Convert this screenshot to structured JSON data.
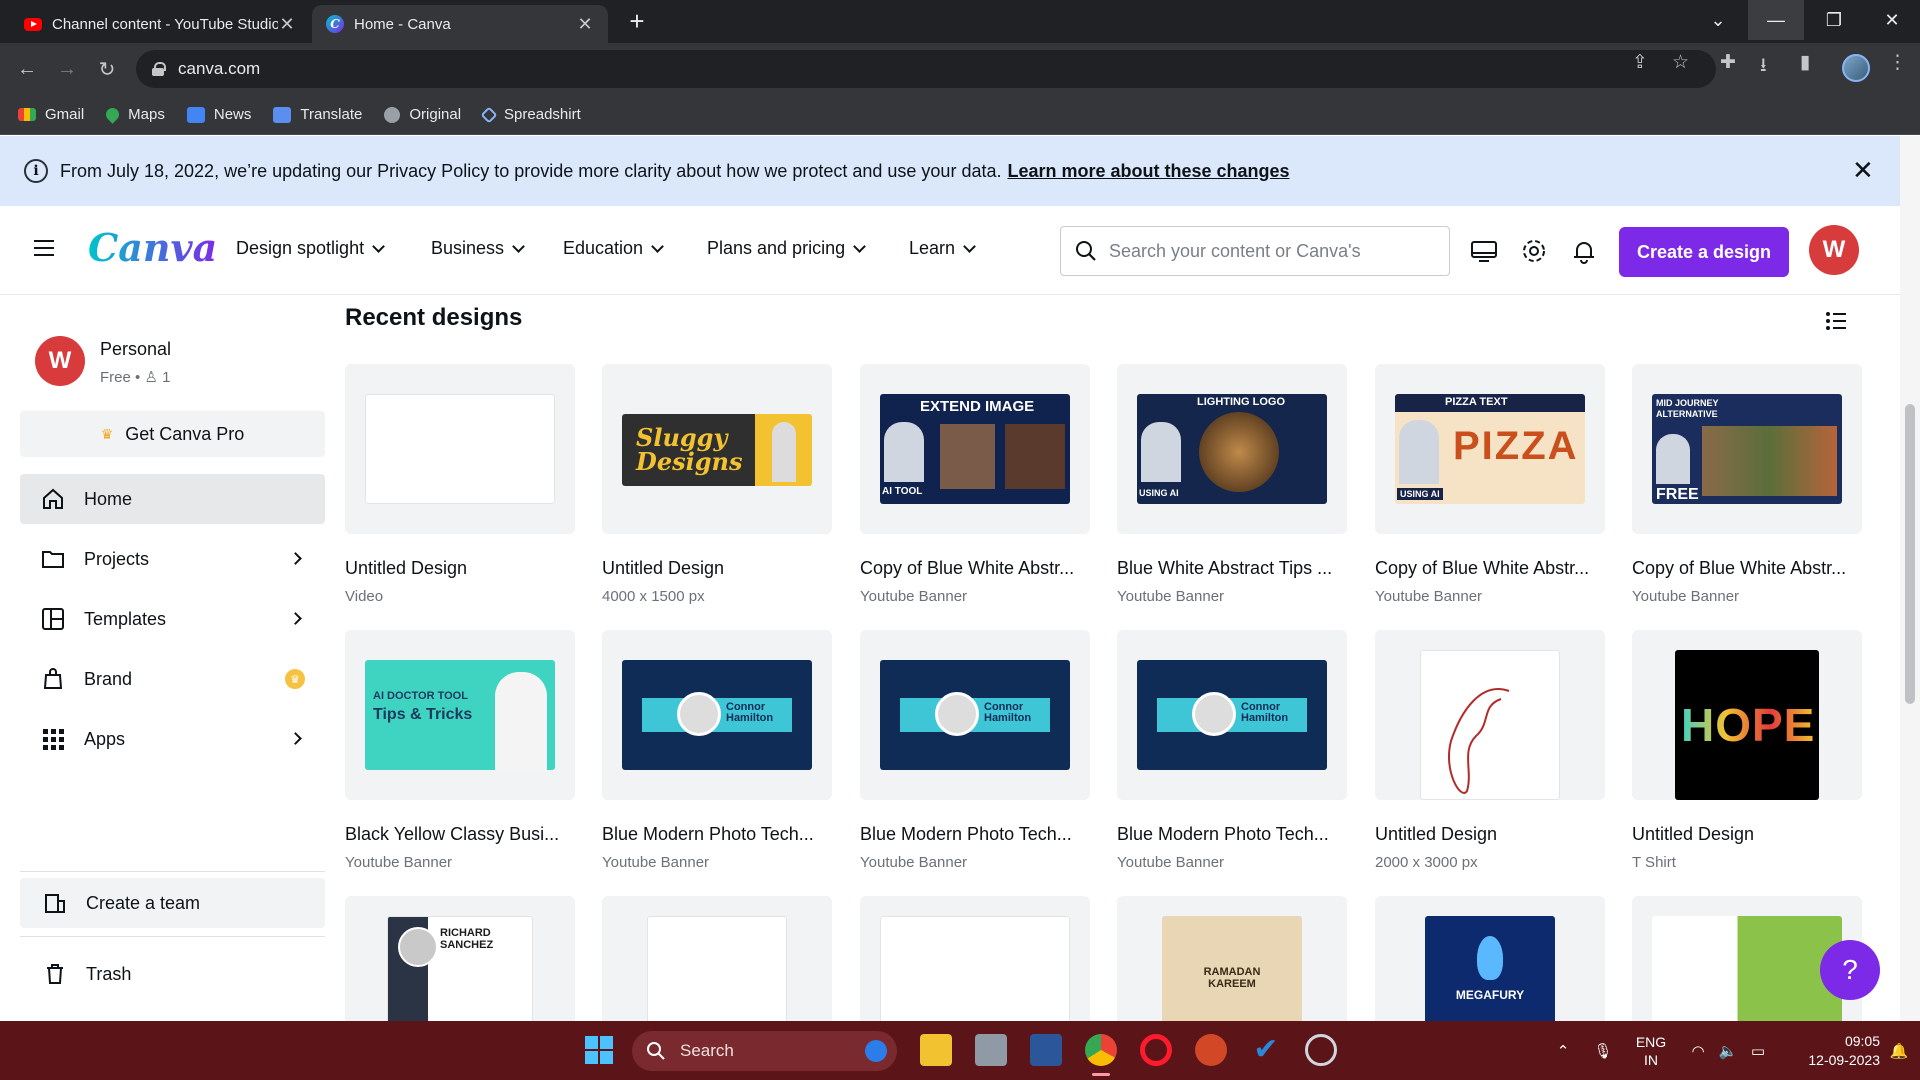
{
  "browser": {
    "tabs": [
      {
        "title": "Channel content - YouTube Studio",
        "favicon": "youtube-icon"
      },
      {
        "title": "Home - Canva",
        "favicon": "canva-icon"
      }
    ],
    "url": "canva.com",
    "bookmarks": [
      "Gmail",
      "Maps",
      "News",
      "Translate",
      "Original",
      "Spreadshirt"
    ]
  },
  "notice": {
    "text": "From July 18, 2022, we’re updating our Privacy Policy to provide more clarity about how we protect and use your data.",
    "link": "Learn more about these changes"
  },
  "header": {
    "logo": "Canva",
    "nav": [
      "Design spotlight",
      "Business",
      "Education",
      "Plans and pricing",
      "Learn"
    ],
    "search_placeholder": "Search your content or Canva's",
    "create_label": "Create a design",
    "user_initial": "W"
  },
  "sidebar": {
    "team_initial": "W",
    "team_name": "Personal",
    "team_plan": "Free •",
    "team_members": "1",
    "pro_label": "Get Canva Pro",
    "items": [
      {
        "label": "Home"
      },
      {
        "label": "Projects"
      },
      {
        "label": "Templates"
      },
      {
        "label": "Brand"
      },
      {
        "label": "Apps"
      }
    ],
    "create_team": "Create a team",
    "trash": "Trash"
  },
  "main": {
    "section_title": "Recent designs",
    "designs": [
      {
        "name": "Untitled Design",
        "sub": "Video"
      },
      {
        "name": "Untitled Design",
        "sub": "4000 x 1500 px",
        "art": "Sluggy Designs"
      },
      {
        "name": "Copy of Blue White Abstr...",
        "sub": "Youtube Banner",
        "art": "EXTEND IMAGE",
        "art2": "AI TOOL"
      },
      {
        "name": "Blue White Abstract Tips ...",
        "sub": "Youtube Banner",
        "art": "LIGHTING LOGO",
        "art2": "USING AI"
      },
      {
        "name": "Copy of Blue White Abstr...",
        "sub": "Youtube Banner",
        "art": "PIZZA TEXT",
        "art2": "USING AI"
      },
      {
        "name": "Copy of Blue White Abstr...",
        "sub": "Youtube Banner",
        "art": "MID JOURNEY ALTERNATIVE",
        "art2": "FREE"
      },
      {
        "name": "Black Yellow Classy Busi...",
        "sub": "Youtube Banner",
        "art": "AI DOCTOR TOOL",
        "art2": "Tips & Tricks"
      },
      {
        "name": "Blue Modern Photo Tech...",
        "sub": "Youtube Banner",
        "art": "Connor Hamilton"
      },
      {
        "name": "Blue Modern Photo Tech...",
        "sub": "Youtube Banner",
        "art": "Connor Hamilton"
      },
      {
        "name": "Blue Modern Photo Tech...",
        "sub": "Youtube Banner",
        "art": "Connor Hamilton"
      },
      {
        "name": "Untitled Design",
        "sub": "2000 x 3000 px"
      },
      {
        "name": "Untitled Design",
        "sub": "T Shirt",
        "art": "HOPE"
      }
    ],
    "row3_art": [
      "RICHARD SANCHEZ",
      "",
      "",
      "RAMADAN KAREEM",
      "MEGAFURY",
      ""
    ]
  },
  "taskbar": {
    "search": "Search",
    "lang_1": "ENG",
    "lang_2": "IN",
    "time": "09:05",
    "date": "12-09-2023"
  },
  "colors": {
    "brand_purple": "#7d2ae8",
    "notice_bg": "#dbe8fb",
    "taskbar_bg": "#5b1418"
  }
}
